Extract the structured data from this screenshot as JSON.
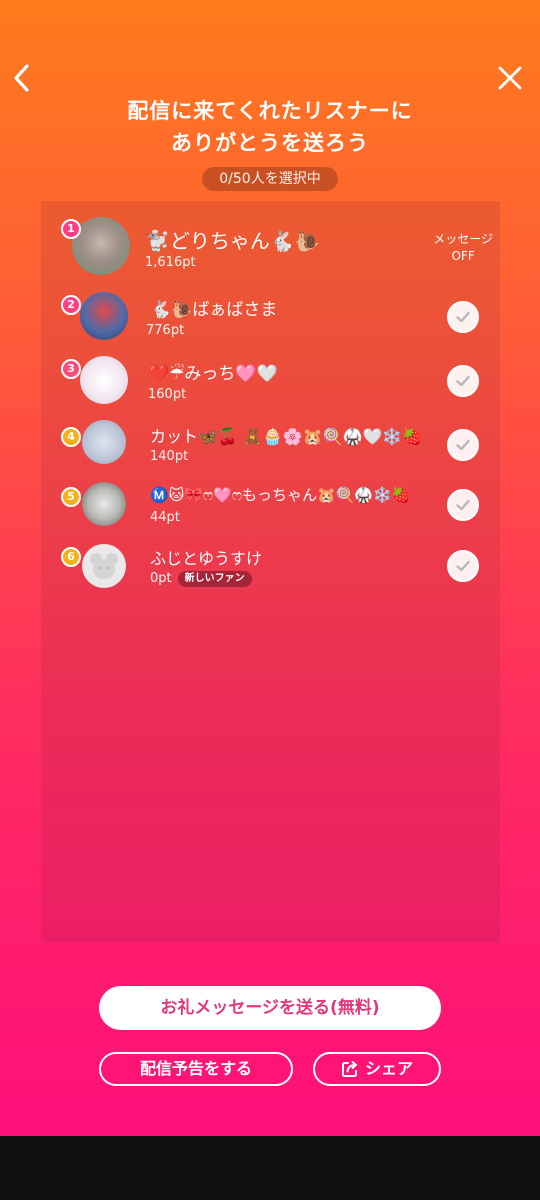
{
  "header": {
    "title_line1": "配信に来てくれたリスナーに",
    "title_line2": "ありがとうを送ろう",
    "selection_count": "0/50人を選択中"
  },
  "colors": {
    "rank1": "#ff3f82",
    "rank2": "#ff3f82",
    "rank3": "#ff4b7a",
    "rank4": "#f5b01a",
    "rank5": "#f5b01a",
    "rank6": "#f5b01a",
    "button_text": "#e0397a"
  },
  "listeners": [
    {
      "rank": "1",
      "name": "🐩どりちゃん🐇🐌",
      "points": "1,616pt",
      "action": "message_off"
    },
    {
      "rank": "2",
      "name": "🐇🐌ばぁばさま",
      "points": "776pt",
      "action": "check"
    },
    {
      "rank": "3",
      "name": "❤️☔みっち🩷🤍",
      "points": "160pt",
      "action": "check"
    },
    {
      "rank": "4",
      "name": "カット🦋🍒 🧸🧁🌸🐹🍭🥋🤍❄️🍓",
      "points": "140pt",
      "action": "check"
    },
    {
      "rank": "5",
      "name": "Ⓜ️🐱🎀ෆ🩷ෆもっちゃん🐹🍭🥋❄️🍓",
      "points": "44pt",
      "action": "check"
    },
    {
      "rank": "6",
      "name": "ふじとゆうすけ",
      "points": "0pt",
      "badge": "新しいファン",
      "action": "check"
    }
  ],
  "message_toggle": {
    "label": "メッセージ",
    "state": "OFF"
  },
  "buttons": {
    "send_message": "お礼メッセージを送る(無料)",
    "announce": "配信予告をする",
    "share": "シェア"
  },
  "icons": {
    "back": "chevron-left-icon",
    "close": "close-icon",
    "check": "checkmark-icon",
    "share": "share-icon"
  }
}
